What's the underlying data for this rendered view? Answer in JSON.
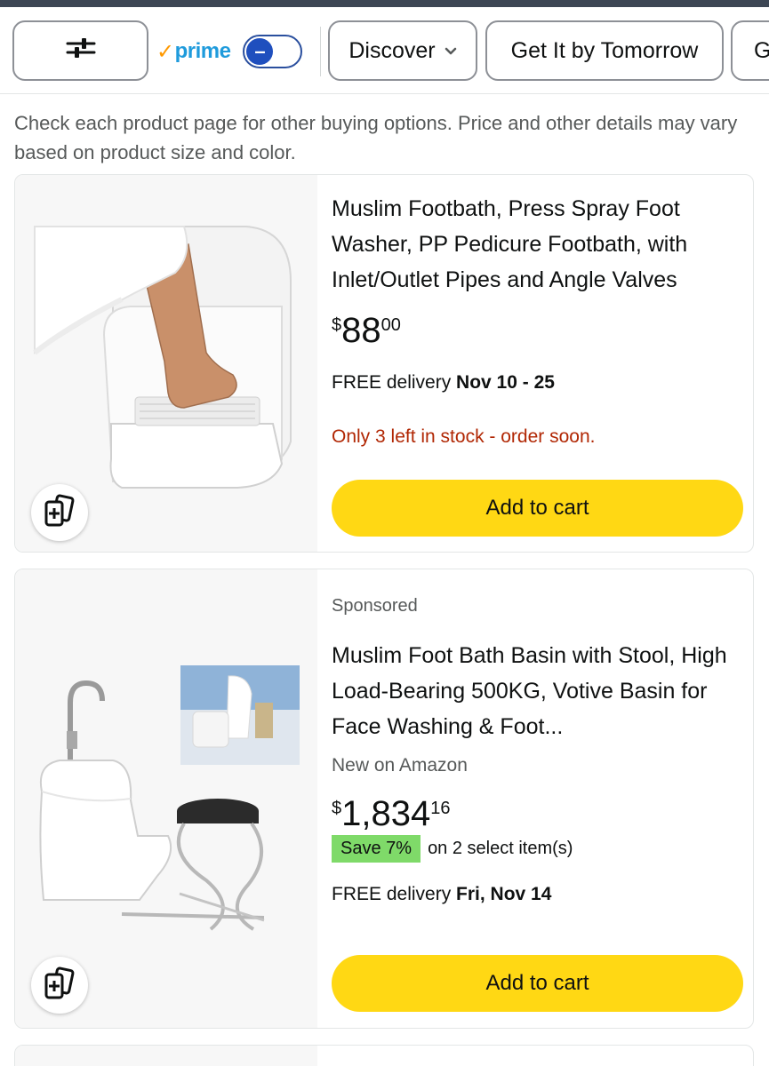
{
  "filters": {
    "prime_label": "prime",
    "discover_label": "Discover",
    "tomorrow_label": "Get It by Tomorrow",
    "more_label": "G"
  },
  "notice": "Check each product page for other buying options. Price and other details may vary based on product size and color.",
  "products": [
    {
      "title": "Muslim Footbath, Press Spray Foot Washer, PP Pedicure Footbath, with Inlet/Outlet Pipes and Angle Valves",
      "price_symbol": "$",
      "price_whole": "88",
      "price_fraction": "00",
      "delivery_prefix": "FREE delivery ",
      "delivery_date": "Nov 10 - 25",
      "stock": "Only 3 left in stock - order soon.",
      "add_to_cart": "Add to cart"
    },
    {
      "sponsored": "Sponsored",
      "title": "Muslim Foot Bath Basin with Stool, High Load-Bearing 500KG, Votive Basin for Face Washing & Foot...",
      "new_on": "New on Amazon",
      "price_symbol": "$",
      "price_whole": "1,834",
      "price_fraction": "16",
      "save_badge": "Save 7%",
      "save_text": "on 2 select item(s)",
      "delivery_prefix": "FREE delivery ",
      "delivery_date": "Fri, Nov 14",
      "add_to_cart": "Add to cart"
    }
  ],
  "colors": {
    "cart_button": "#ffd814",
    "stock_warning": "#b12704",
    "save_badge": "#7fda69",
    "prime_blue": "#1f9bdc"
  }
}
